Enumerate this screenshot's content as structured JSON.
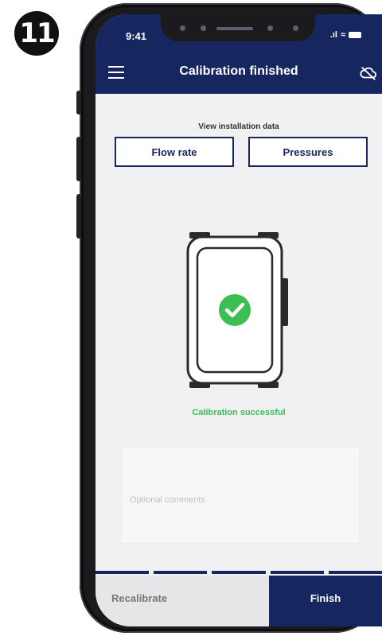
{
  "step": {
    "number": "11"
  },
  "status_bar": {
    "time": "9:41",
    "signal_icon": "signal-icon",
    "wifi_icon": "wifi-icon",
    "battery_icon": "battery-icon"
  },
  "header": {
    "title": "Calibration finished",
    "menu_icon": "hamburger-menu-icon",
    "cloud_icon": "cloud-off-icon"
  },
  "installation": {
    "label": "View installation data",
    "buttons": [
      "Flow rate",
      "Pressures"
    ]
  },
  "result": {
    "icon": "check-circle-icon",
    "message": "Calibration successful"
  },
  "comments": {
    "placeholder": "Optional comments"
  },
  "footer": {
    "recalibrate_label": "Recalibrate",
    "finish_label": "Finish"
  },
  "colors": {
    "primary": "#16265f",
    "success": "#3bbf55",
    "background": "#f1f1f3"
  }
}
